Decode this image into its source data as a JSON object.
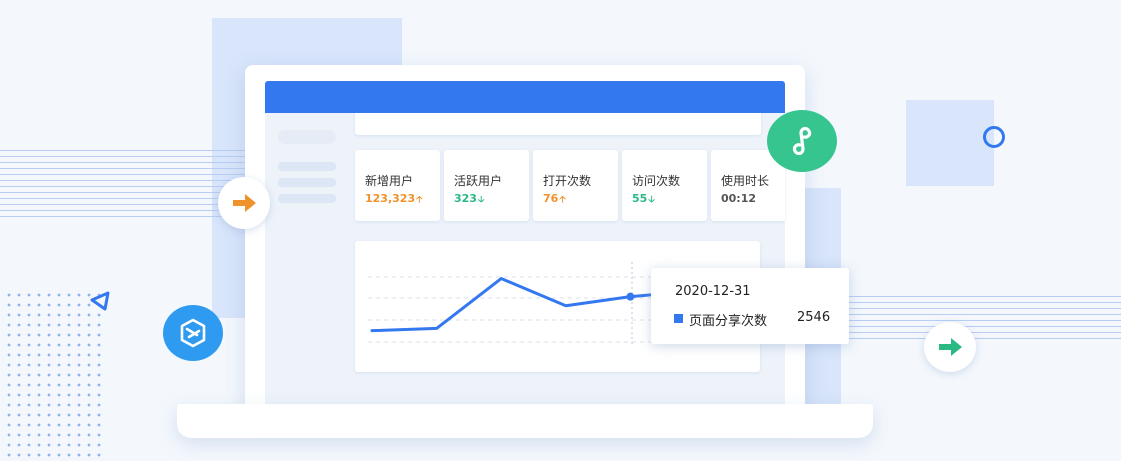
{
  "stats": [
    {
      "label": "新增用户",
      "value": "123,323",
      "trend": "up",
      "color": "#f0922b"
    },
    {
      "label": "活跃用户",
      "value": "323",
      "trend": "down",
      "color": "#2bb983"
    },
    {
      "label": "打开次数",
      "value": "76",
      "trend": "up",
      "color": "#f0922b"
    },
    {
      "label": "访问次数",
      "value": "55",
      "trend": "down",
      "color": "#2bb983"
    },
    {
      "label": "使用时长",
      "value": "00:12",
      "trend": "none",
      "color": "#555555"
    }
  ],
  "tooltip": {
    "date": "2020-12-31",
    "series_name": "页面分享次数",
    "value": "2546"
  },
  "chart_data": {
    "type": "line",
    "series": [
      {
        "name": "页面分享次数",
        "color": "#3478f0",
        "values": [
          1,
          1.2,
          5.6,
          3.2,
          4,
          4.5
        ]
      }
    ],
    "grid": true,
    "highlighted_index": 4
  },
  "colors": {
    "accent": "#3478f0",
    "orange": "#f0922b",
    "green": "#2bb983",
    "miniprogram_green": "#36c58e",
    "logo_blue": "#2f9bf0"
  },
  "icons": {
    "left_badge": "arrow-right-icon",
    "right_badge": "arrow-right-icon",
    "miniprogram": "link-icon",
    "logo": "hexagon-logo-icon",
    "triangle": "triangle-outline-icon",
    "ring": "ring-icon"
  }
}
